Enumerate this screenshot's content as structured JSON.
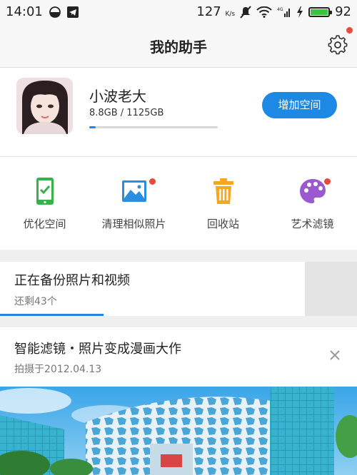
{
  "status_bar": {
    "time": "14:01",
    "speed": "127",
    "speed_unit": "K/s",
    "battery_percent": "92",
    "battery_level": 0.92,
    "icons": [
      "moon-icon",
      "telegram-icon",
      "mute-icon",
      "wifi-icon",
      "cellular-4g-icon",
      "charging-icon",
      "battery-icon"
    ]
  },
  "header": {
    "title": "我的助手",
    "settings_icon": "gear-icon",
    "settings_has_badge": true
  },
  "profile": {
    "username": "小波老大",
    "storage_text": "8.8GB / 1125GB",
    "storage_used_fraction": 0.05,
    "add_space_label": "增加空间"
  },
  "tools": [
    {
      "label": "优化空间",
      "icon": "phone-check-icon",
      "color": "#35b24a",
      "badge": false
    },
    {
      "label": "清理相似照片",
      "icon": "gallery-icon",
      "color": "#2a8ee0",
      "badge": true
    },
    {
      "label": "回收站",
      "icon": "trash-icon",
      "color": "#f5a623",
      "badge": false
    },
    {
      "label": "艺术滤镜",
      "icon": "palette-icon",
      "color": "#9b59d0",
      "badge": true
    }
  ],
  "backup": {
    "title": "正在备份照片和视频",
    "remaining": "还剩43个",
    "progress_fraction": 0.29
  },
  "feature_card": {
    "title": "智能滤镜・照片变成漫画大作",
    "date": "拍摄于2012.04.13",
    "close_icon": "close-icon"
  },
  "colors": {
    "accent": "#1e88e5",
    "badge": "#e84a3d"
  }
}
